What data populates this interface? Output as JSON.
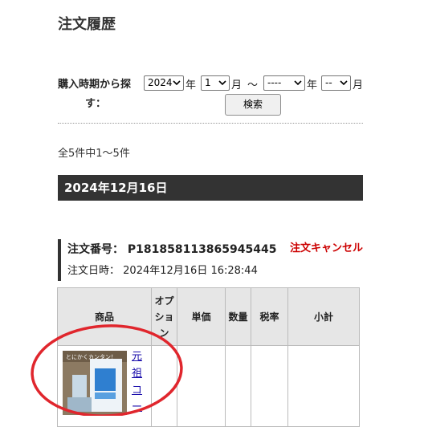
{
  "page": {
    "title": "注文履歴"
  },
  "filter": {
    "label": "購入時期から探す：",
    "label_line1": "購入時期から探",
    "label_line2": "す：",
    "from_year": "2024",
    "from_month": "1",
    "to_year": "----",
    "to_month": "--",
    "unit_year": "年",
    "unit_month": "月",
    "tilde": "～",
    "search_label": "検索"
  },
  "summary": "全5件中1～5件",
  "order": {
    "date_header": "2024年12月16日",
    "number_label": "注文番号：",
    "number": "P181858113865945445",
    "cancel_label": "注文キャンセル",
    "date_label": "注文日時：",
    "datetime": "2024年12月16日 16:28:44"
  },
  "table": {
    "headers": [
      "商品",
      "オプション",
      "単価",
      "数量",
      "税率",
      "小計"
    ],
    "first_item": {
      "name_visible": "元祖コー",
      "thumb_caption": "とにかくカンタン！"
    }
  },
  "colors": {
    "accent_red": "#cc0000",
    "dark_bar": "#333333",
    "link": "#1a0dab",
    "header_bg": "#e6e6e6"
  }
}
